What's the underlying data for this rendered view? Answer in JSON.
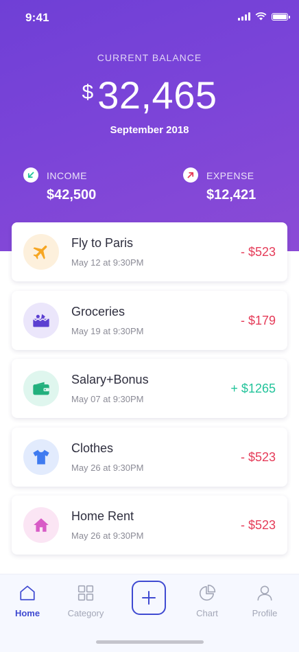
{
  "status": {
    "time": "9:41"
  },
  "balance": {
    "label": "CURRENT BALANCE",
    "currency": "$",
    "amount": "32,465",
    "period": "September 2018"
  },
  "income": {
    "label": "INCOME",
    "value": "$42,500",
    "icon": "arrow-down-left-icon",
    "color": "#22c39a"
  },
  "expense": {
    "label": "EXPENSE",
    "value": "$12,421",
    "icon": "arrow-up-right-icon",
    "color": "#e53b58"
  },
  "transactions": [
    {
      "title": "Fly to Paris",
      "date": "May 12 at 9:30PM",
      "amount": "- $523",
      "type": "expense",
      "icon": "airplane-icon",
      "icon_bg": "#fdf0dc",
      "icon_color": "#f6a623"
    },
    {
      "title": "Groceries",
      "date": "May 19 at 9:30PM",
      "amount": "- $179",
      "type": "expense",
      "icon": "grocery-basket-icon",
      "icon_bg": "#ebe6fb",
      "icon_color": "#5b3fd1"
    },
    {
      "title": "Salary+Bonus",
      "date": "May 07 at 9:30PM",
      "amount": "+ $1265",
      "type": "income",
      "icon": "wallet-icon",
      "icon_bg": "#dff6ee",
      "icon_color": "#22b07d"
    },
    {
      "title": "Clothes",
      "date": "May 26 at 9:30PM",
      "amount": "- $523",
      "type": "expense",
      "icon": "tshirt-icon",
      "icon_bg": "#e2ebfd",
      "icon_color": "#3f7bf0"
    },
    {
      "title": "Home Rent",
      "date": "May 26 at 9:30PM",
      "amount": "- $523",
      "type": "expense",
      "icon": "house-icon",
      "icon_bg": "#fbe5f4",
      "icon_color": "#d85bc6"
    }
  ],
  "tabbar": {
    "tabs": [
      {
        "label": "Home",
        "icon": "home-icon",
        "active": true
      },
      {
        "label": "Category",
        "icon": "category-grid-icon",
        "active": false
      },
      {
        "label": "Chart",
        "icon": "pie-chart-icon",
        "active": false
      },
      {
        "label": "Profile",
        "icon": "user-icon",
        "active": false
      }
    ],
    "add_icon": "plus-icon",
    "active_color": "#3f4ad1"
  },
  "colors": {
    "header_gradient_start": "#6f3fd6",
    "header_gradient_end": "#8b4bd6"
  }
}
